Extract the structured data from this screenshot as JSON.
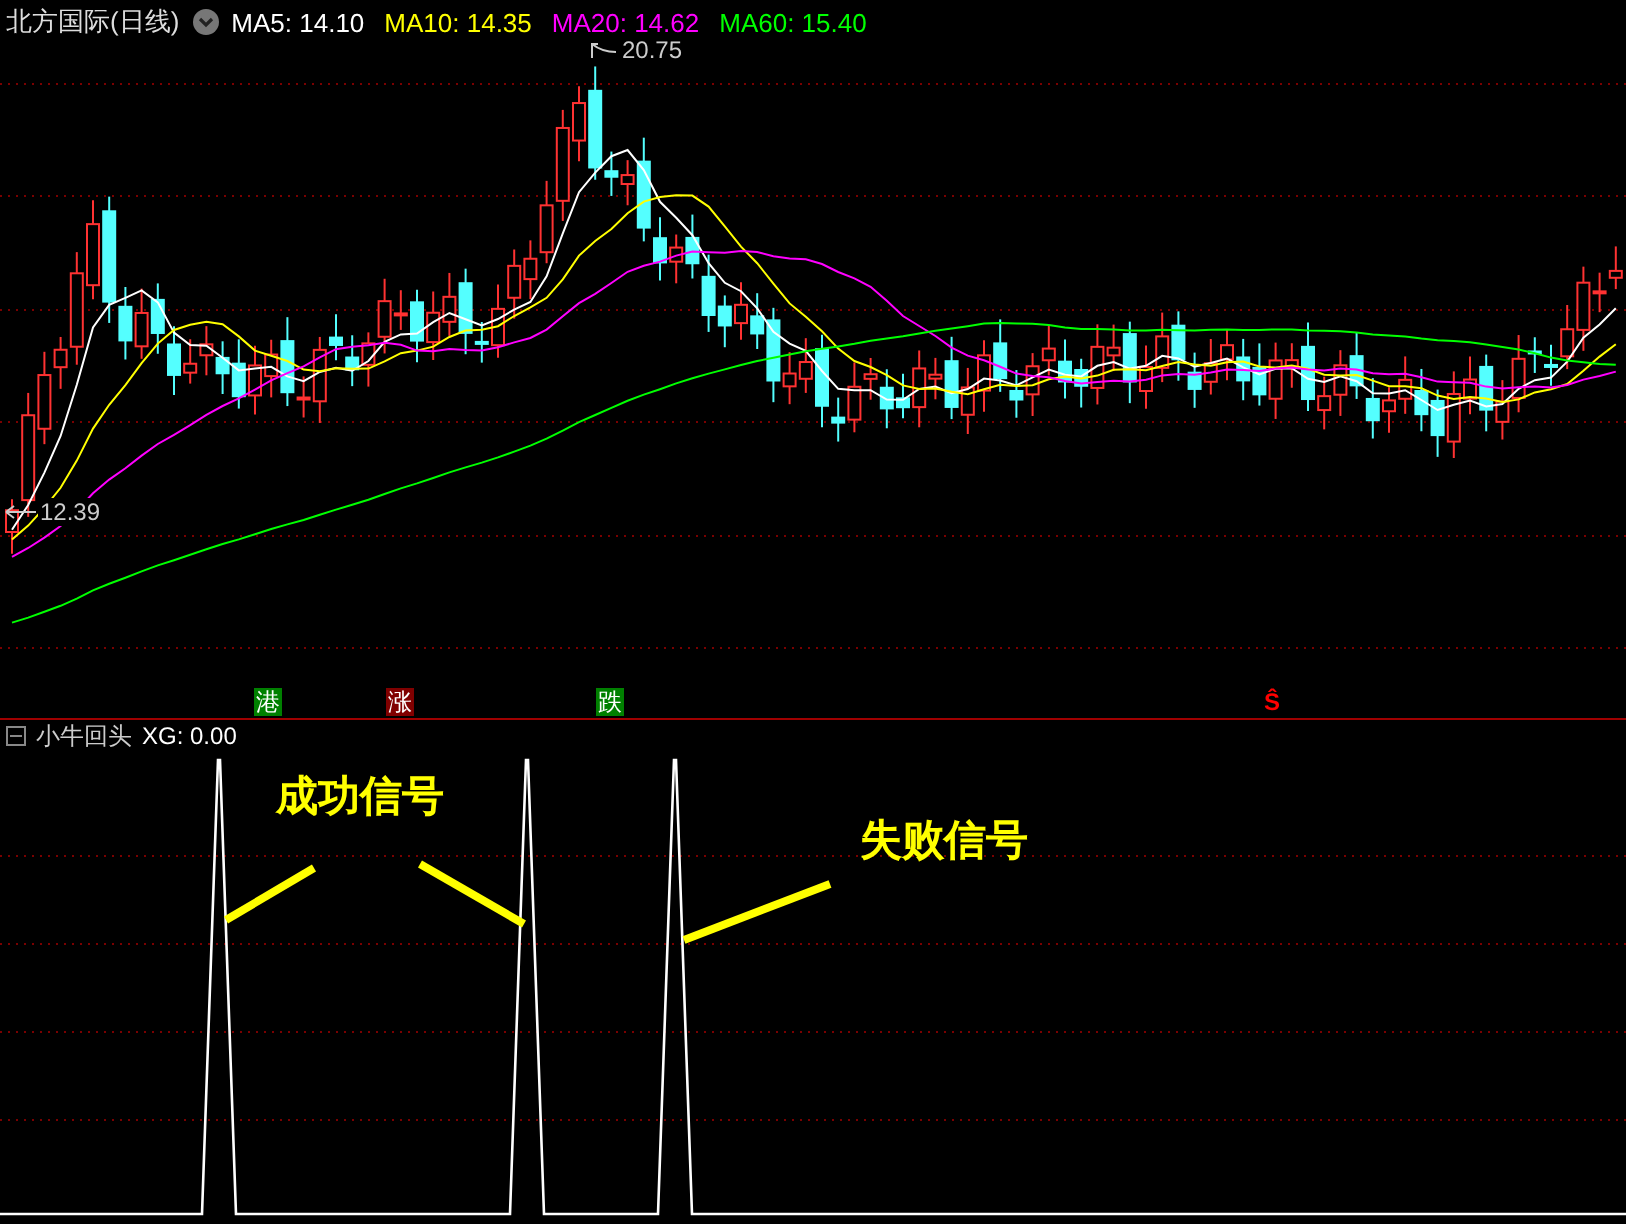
{
  "header": {
    "title": "北方国际(日线)",
    "indicators": [
      {
        "label": "MA5: 14.10",
        "color": "#ffffff"
      },
      {
        "label": "MA10: 14.35",
        "color": "#ffff00"
      },
      {
        "label": "MA20: 14.62",
        "color": "#ff00ff"
      },
      {
        "label": "MA60: 15.40",
        "color": "#00ff00"
      }
    ]
  },
  "price_chart": {
    "high_label": "20.75",
    "low_label": "12.39",
    "markers": [
      {
        "text": "港",
        "kind": "tag",
        "color": "#008000"
      },
      {
        "text": "涨",
        "kind": "tag",
        "color": "#800000"
      },
      {
        "text": "跌",
        "kind": "tag",
        "color": "#008000"
      },
      {
        "text": "Ŝ",
        "kind": "signal",
        "color": "#ff0000"
      }
    ]
  },
  "indicator_panel": {
    "title": "小牛回头",
    "reading": "XG: 0.00",
    "annotations": [
      {
        "text": "成功信号"
      },
      {
        "text": "失败信号"
      }
    ]
  }
}
